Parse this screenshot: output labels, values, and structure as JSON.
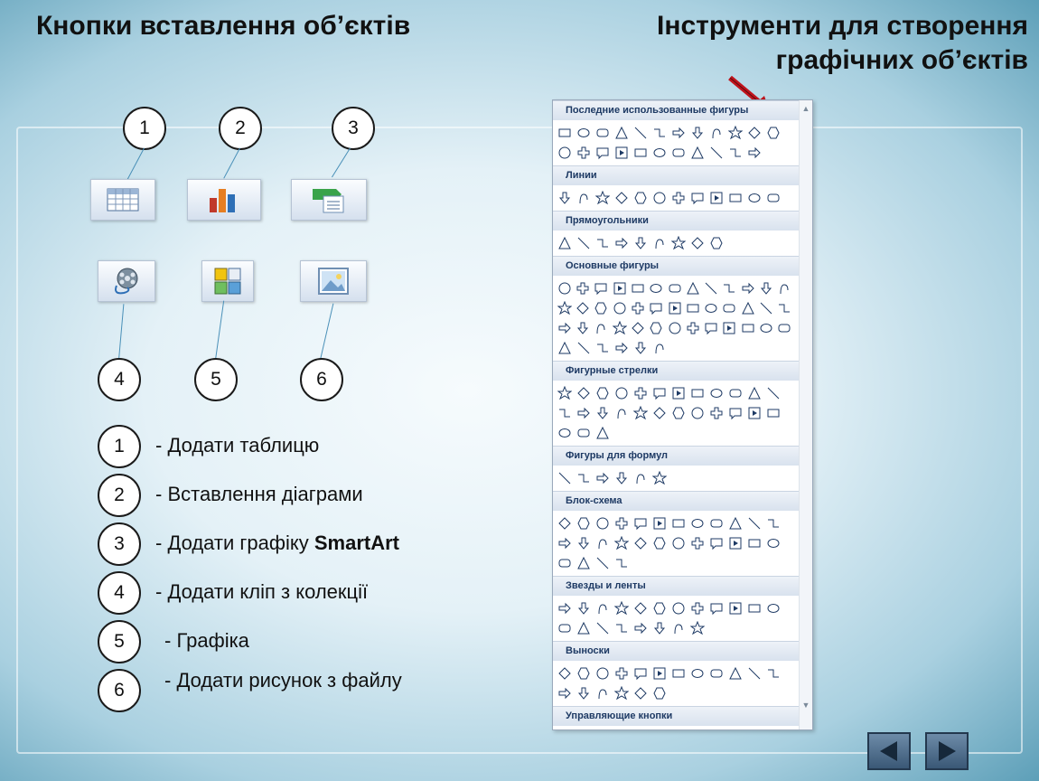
{
  "titles": {
    "left": "Кнопки вставлення об’єктів",
    "right_line1": "Інструменти для створення",
    "right_line2": "графічних об’єктів"
  },
  "callouts_top": [
    "1",
    "2",
    "3"
  ],
  "callouts_bottom": [
    "4",
    "5",
    "6"
  ],
  "toolbar_buttons": [
    {
      "icon": "table-icon"
    },
    {
      "icon": "chart-icon"
    },
    {
      "icon": "smartart-icon"
    },
    {
      "icon": "clip-art-icon"
    },
    {
      "icon": "graphics-icon"
    },
    {
      "icon": "picture-icon"
    }
  ],
  "legend": [
    {
      "num": "1",
      "text": "- Додати таблицю"
    },
    {
      "num": "2",
      "text": "- Вставлення діаграми"
    },
    {
      "num": "3",
      "text": "- Додати графіку ",
      "bold": "SmartArt"
    },
    {
      "num": "4",
      "text": "- Додати кліп з колекції"
    },
    {
      "num": "5",
      "text": "- Графіка"
    },
    {
      "num": "6",
      "text": "- Додати рисунок з файлу"
    }
  ],
  "shapes_panel": {
    "sections": [
      "Последние использованные фигуры",
      "Линии",
      "Прямоугольники",
      "Основные фигуры",
      "Фигурные стрелки",
      "Фигуры для формул",
      "Блок-схема",
      "Звезды и ленты",
      "Выноски",
      "Управляющие кнопки"
    ]
  },
  "accent_colors": {
    "arrow": "#c0141c",
    "lines": "#4a90b8",
    "header_text": "#1e3a64"
  }
}
